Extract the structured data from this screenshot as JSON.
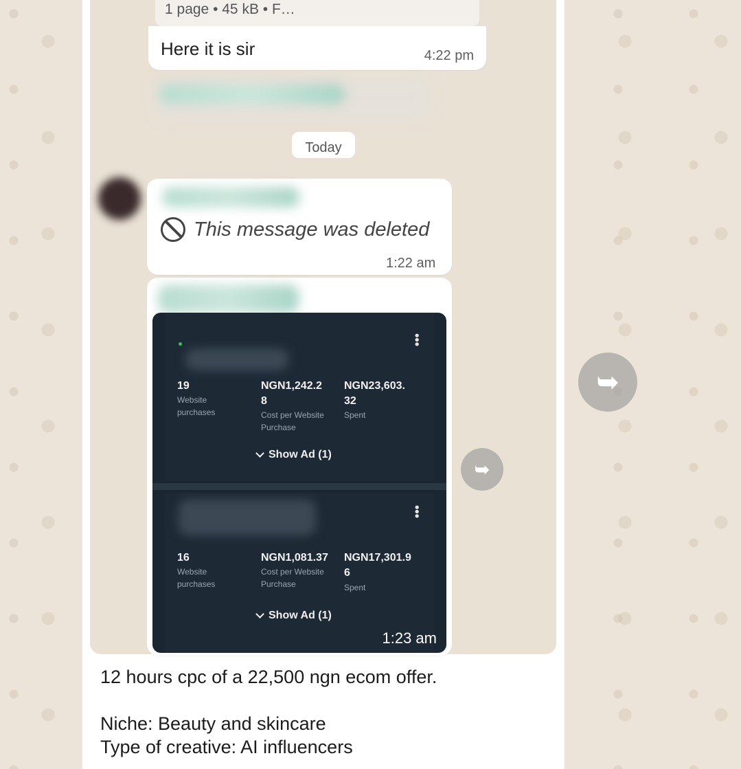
{
  "chat": {
    "file_info": "1 page • 45 kB • F…",
    "reply_text": "Here it is sir",
    "reply_time": "4:22 pm",
    "date_chip": "Today",
    "deleted_text": "This message was deleted",
    "deleted_time": "1:22 am",
    "image_time": "1:23 am"
  },
  "ads": [
    {
      "purchases": "19",
      "purchases_label": "Website purchases",
      "cost_line1": "NGN1,242.2",
      "cost_line2": "8",
      "cost_label": "Cost per Website Purchase",
      "spent_line1": "NGN23,603.",
      "spent_line2": "32",
      "spent_label": "Spent",
      "show_ad": "Show Ad (1)"
    },
    {
      "purchases": "16",
      "purchases_label": "Website purchases",
      "cost_line1": "NGN1,081.37",
      "cost_label": "Cost per Website Purchase",
      "spent_line1": "NGN17,301.9",
      "spent_line2": "6",
      "spent_label": "Spent",
      "show_ad": "Show Ad (1)"
    }
  ],
  "caption": {
    "line1": "12 hours cpc of a 22,500 ngn  ecom offer.",
    "line2": "Niche: Beauty and skincare",
    "line3": "Type of creative: AI influencers"
  },
  "icons": {
    "deleted": "ban-icon",
    "forward": "forward-icon",
    "menu": "kebab-menu-icon",
    "show": "chevron-down-icon"
  }
}
